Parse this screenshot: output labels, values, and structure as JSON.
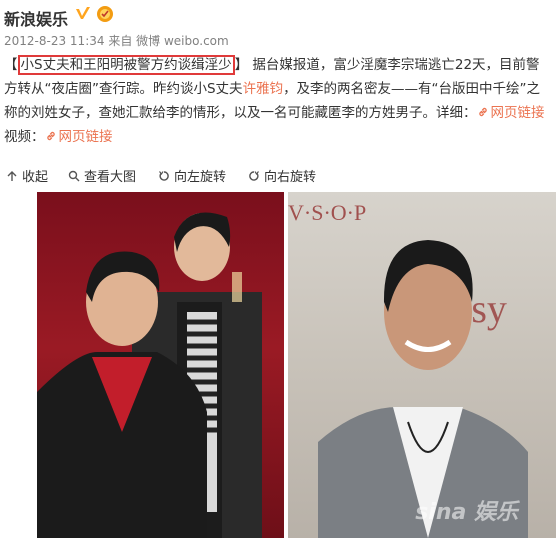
{
  "header": {
    "author": "新浪娱乐",
    "verified_icon": "verified-v-badge",
    "medal_icon": "medal-badge",
    "timestamp": "2012-8-23 11:34",
    "source_prefix": "来自",
    "source": "微博 weibo.com"
  },
  "post": {
    "open_bracket": "【",
    "title": "小S丈夫和王阳明被警方约谈缉淫少",
    "close_bracket": "】",
    "body_1": "据台媒报道，富少淫魔李宗瑞逃亡22天，目前警方转从“夜店圈”查行踪。昨约谈小S丈夫",
    "mention_name": "许雅钧",
    "body_2": "，及李的两名密友——有“台版田中千绘”之称的刘姓女子，查她汇款给李的情形，以及一名可能藏匿李的方姓男子。详细：",
    "link1_label": "网页链接",
    "video_label": "视频：",
    "link2_label": "网页链接"
  },
  "toolbar": {
    "collapse": "收起",
    "view_large": "查看大图",
    "rotate_left": "向左旋转",
    "rotate_right": "向右旋转"
  },
  "photo": {
    "watermark": "sina 娱乐"
  },
  "colors": {
    "link": "#eb7350",
    "highlight_box": "#e03a3a",
    "meta_text": "#808080",
    "body_text": "#333333",
    "verified_badge": "#ffa51f"
  }
}
